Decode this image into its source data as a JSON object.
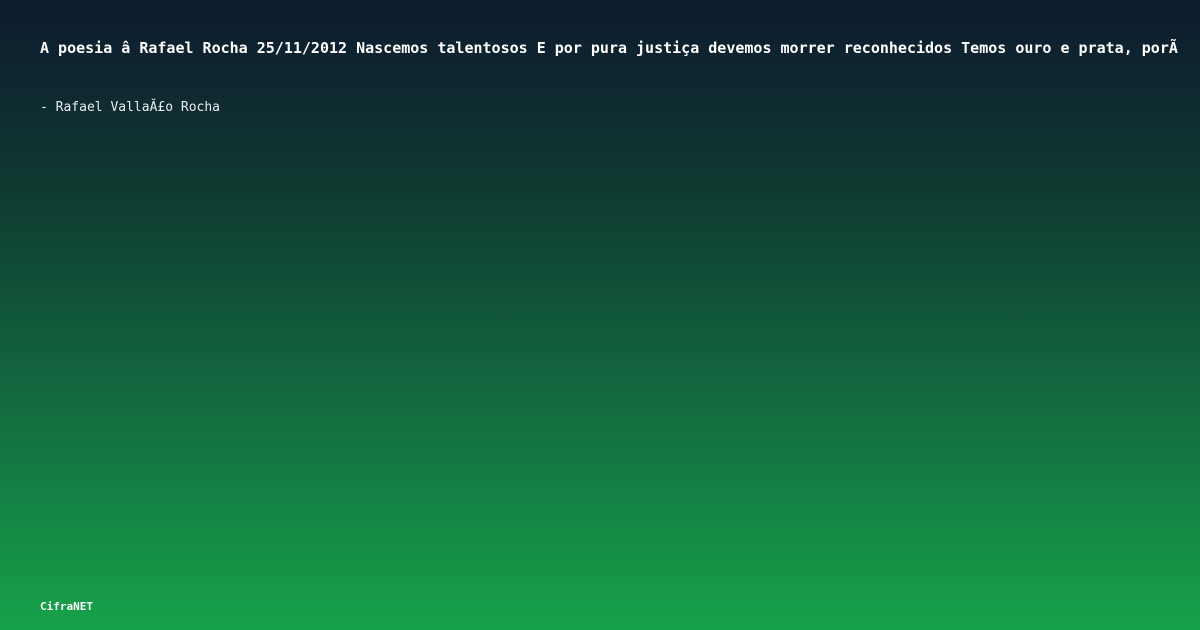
{
  "quote": {
    "text": "A poesia â   Rafael Rocha 25/11/2012 Nascemos talentosos E por pura justiça devemos morrer reconhecidos Temos ouro e prata, porÃ"
  },
  "author": {
    "text": "- Rafael VallaĂ£o Rocha"
  },
  "brand": {
    "name": "CifraNET"
  },
  "colors": {
    "background_top": "#0e1a2e",
    "background_bottom": "#16a249",
    "text": "#ffffff"
  }
}
